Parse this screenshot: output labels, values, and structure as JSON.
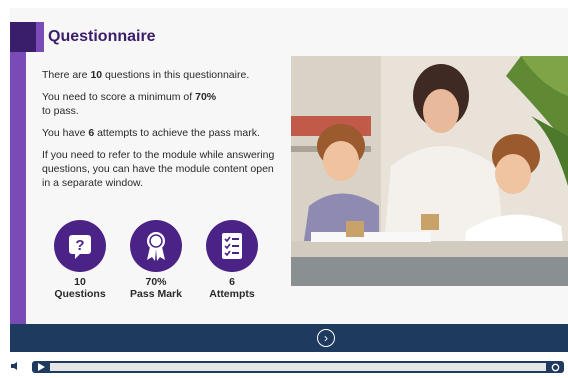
{
  "header": {
    "title": "Questionnaire"
  },
  "intro": {
    "p1_a": "There are ",
    "p1_b": "10",
    "p1_c": " questions in this questionnaire.",
    "p2_a": "You need to score a minimum of ",
    "p2_b": "70%",
    "p2_c": "to pass.",
    "p3_a": "You have ",
    "p3_b": "6",
    "p3_c": " attempts to achieve the pass mark.",
    "p4": "If you need to refer to the module while answering questions, you can have the module content open in a separate window."
  },
  "stats": [
    {
      "icon": "question-mark-icon",
      "value": "10",
      "label": "Questions"
    },
    {
      "icon": "award-ribbon-icon",
      "value": "70%",
      "label": "Pass Mark"
    },
    {
      "icon": "checklist-icon",
      "value": "6",
      "label": "Attempts"
    }
  ],
  "colors": {
    "accent_dark": "#3b1e6b",
    "accent": "#7a4bb6",
    "icon_circle": "#4b2386",
    "nav_bar": "#1e3a5e"
  },
  "nav": {
    "next_icon": "chevron-right-circle-icon"
  },
  "player": {
    "progress_fraction": 0.0
  }
}
